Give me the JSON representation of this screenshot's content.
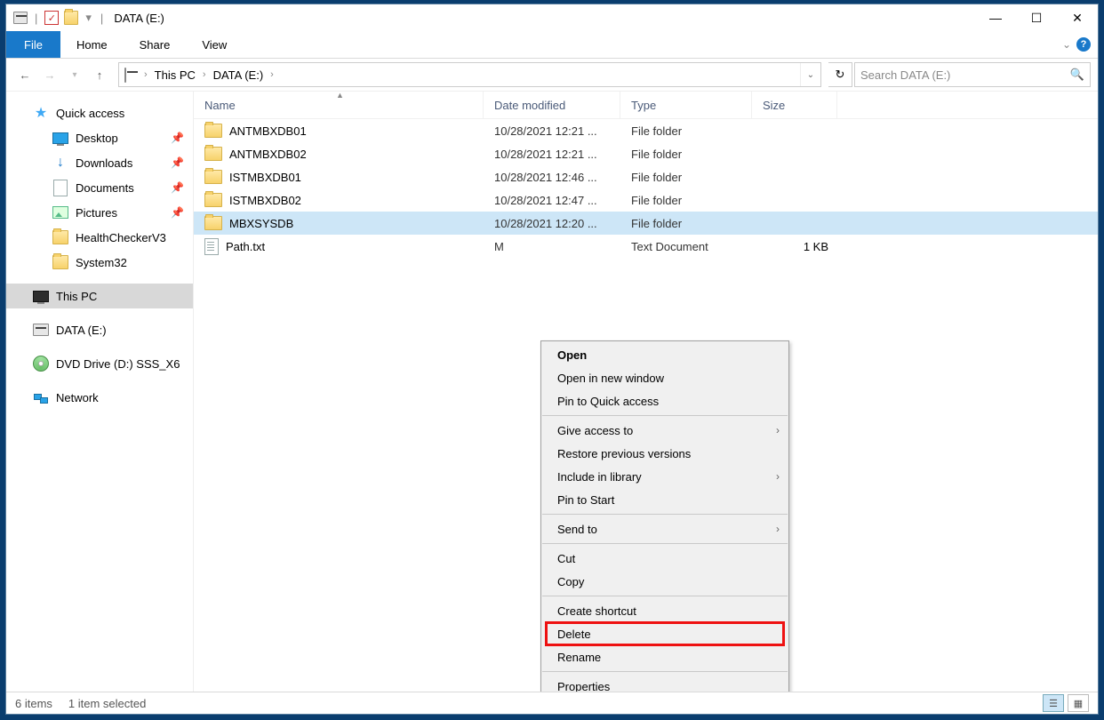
{
  "titlebar": {
    "title": "DATA (E:)"
  },
  "ribbon": {
    "file": "File",
    "home": "Home",
    "share": "Share",
    "view": "View"
  },
  "address": {
    "crumbs": [
      "This PC",
      "DATA (E:)"
    ],
    "search_placeholder": "Search DATA (E:)"
  },
  "navpane": {
    "quick_access": "Quick access",
    "desktop": "Desktop",
    "downloads": "Downloads",
    "documents": "Documents",
    "pictures": "Pictures",
    "healthchecker": "HealthCheckerV3",
    "system32": "System32",
    "this_pc": "This PC",
    "data_e": "DATA (E:)",
    "dvd": "DVD Drive (D:) SSS_X6",
    "network": "Network"
  },
  "columns": {
    "name": "Name",
    "date": "Date modified",
    "type": "Type",
    "size": "Size"
  },
  "rows": [
    {
      "name": "ANTMBXDB01",
      "date": "10/28/2021 12:21 ...",
      "type": "File folder",
      "size": "",
      "icon": "folder",
      "selected": false
    },
    {
      "name": "ANTMBXDB02",
      "date": "10/28/2021 12:21 ...",
      "type": "File folder",
      "size": "",
      "icon": "folder",
      "selected": false
    },
    {
      "name": "ISTMBXDB01",
      "date": "10/28/2021 12:46 ...",
      "type": "File folder",
      "size": "",
      "icon": "folder",
      "selected": false
    },
    {
      "name": "ISTMBXDB02",
      "date": "10/28/2021 12:47 ...",
      "type": "File folder",
      "size": "",
      "icon": "folder",
      "selected": false
    },
    {
      "name": "MBXSYSDB",
      "date": "10/28/2021 12:20 ...",
      "type": "File folder",
      "size": "",
      "icon": "folder",
      "selected": true
    },
    {
      "name": "Path.txt",
      "date": "M",
      "type": "Text Document",
      "size": "1 KB",
      "icon": "file",
      "selected": false
    }
  ],
  "context_menu": {
    "open": "Open",
    "open_new_window": "Open in new window",
    "pin_quick": "Pin to Quick access",
    "give_access": "Give access to",
    "restore_prev": "Restore previous versions",
    "include_library": "Include in library",
    "pin_start": "Pin to Start",
    "send_to": "Send to",
    "cut": "Cut",
    "copy": "Copy",
    "create_shortcut": "Create shortcut",
    "delete": "Delete",
    "rename": "Rename",
    "properties": "Properties"
  },
  "statusbar": {
    "count": "6 items",
    "selection": "1 item selected"
  }
}
